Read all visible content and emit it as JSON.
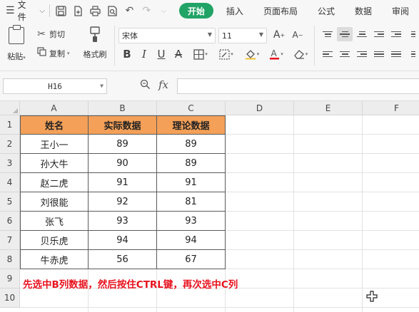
{
  "menu": {
    "file_label": "文件",
    "tabs": [
      "开始",
      "插入",
      "页面布局",
      "公式",
      "数据",
      "审阅"
    ],
    "active_tab_index": 0,
    "accent_color": "#21a366"
  },
  "ribbon": {
    "paste_label": "粘贴",
    "cut_label": "剪切",
    "copy_label": "复制",
    "format_painter_label": "格式刷",
    "font_name": "宋体",
    "font_size": "11"
  },
  "formula_bar": {
    "cell_ref": "H16",
    "fx_label": "fx",
    "formula": ""
  },
  "sheet": {
    "columns": [
      "A",
      "B",
      "C",
      "D",
      "E",
      "F"
    ],
    "rows": [
      "1",
      "2",
      "3",
      "4",
      "5",
      "6",
      "7",
      "8",
      "9",
      "10"
    ],
    "header_fill": "#f4a058",
    "table_headers": [
      "姓名",
      "实际数据",
      "理论数据"
    ],
    "table_rows": [
      [
        "王小一",
        "89",
        "89"
      ],
      [
        "孙大牛",
        "90",
        "89"
      ],
      [
        "赵二虎",
        "91",
        "91"
      ],
      [
        "刘很能",
        "92",
        "81"
      ],
      [
        "张飞",
        "93",
        "93"
      ],
      [
        "贝乐虎",
        "94",
        "94"
      ],
      [
        "牛赤虎",
        "56",
        "67"
      ]
    ],
    "note": "先选中B列数据，然后按住CTRL键，再次选中C列",
    "note_color": "#e8121e"
  }
}
